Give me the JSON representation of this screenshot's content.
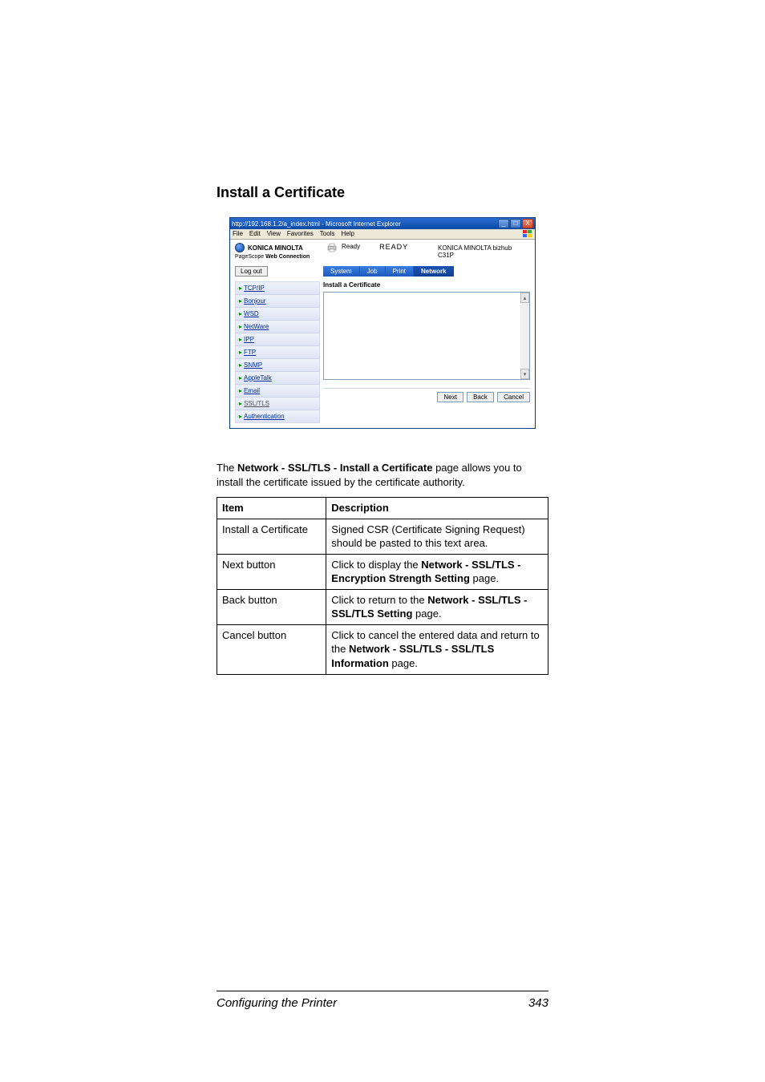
{
  "heading": "Install a Certificate",
  "ie": {
    "title": "http://192.168.1.2/a_index.html - Microsoft Internet Explorer",
    "menus": [
      "File",
      "Edit",
      "View",
      "Favorites",
      "Tools",
      "Help"
    ],
    "wbtn": {
      "min": "_",
      "max": "□",
      "close": "X"
    }
  },
  "brand": {
    "name": "KONICA MINOLTA",
    "sub_prefix": "PageScope",
    "sub_b": "Web Connection"
  },
  "status": {
    "ready_small": "Ready",
    "ready_big": "READY"
  },
  "model": {
    "line1": "KONICA MINOLTA bizhub",
    "line2": "C31P"
  },
  "logout": "Log out",
  "tabs": [
    "System",
    "Job",
    "Print",
    "Network"
  ],
  "sidebar": {
    "items": [
      {
        "label": "TCP/IP"
      },
      {
        "label": "Bonjour"
      },
      {
        "label": "WSD"
      },
      {
        "label": "NetWare"
      },
      {
        "label": "IPP"
      },
      {
        "label": "FTP"
      },
      {
        "label": "SNMP"
      },
      {
        "label": "AppleTalk"
      },
      {
        "label": "Email"
      },
      {
        "label": "SSL/TLS"
      },
      {
        "label": "Authentication"
      }
    ]
  },
  "content_title": "Install a Certificate",
  "buttons": {
    "next": "Next",
    "back": "Back",
    "cancel": "Cancel"
  },
  "paragraph": {
    "pre": "The ",
    "bold": "Network - SSL/TLS - Install a Certificate",
    "post": " page allows you to install the certificate issued by the certificate authority."
  },
  "table": {
    "head": {
      "c1": "Item",
      "c2": "Description"
    },
    "rows": [
      {
        "c1": "Install a Certificate",
        "c2": "Signed CSR (Certificate Signing Request) should be pasted to this text area."
      },
      {
        "c1": "Next button",
        "c2_pre": "Click to display the ",
        "c2_b": "Network - SSL/TLS - Encryption Strength Setting",
        "c2_post": " page."
      },
      {
        "c1": "Back button",
        "c2_pre": "Click to return to the ",
        "c2_b": "Network - SSL/TLS - SSL/TLS Setting",
        "c2_post": " page."
      },
      {
        "c1": "Cancel button",
        "c2_pre": "Click to cancel the entered data and return to the ",
        "c2_b": "Network - SSL/TLS - SSL/TLS Information",
        "c2_post": " page."
      }
    ]
  },
  "footer": {
    "title": "Configuring the Printer",
    "page": "343"
  }
}
